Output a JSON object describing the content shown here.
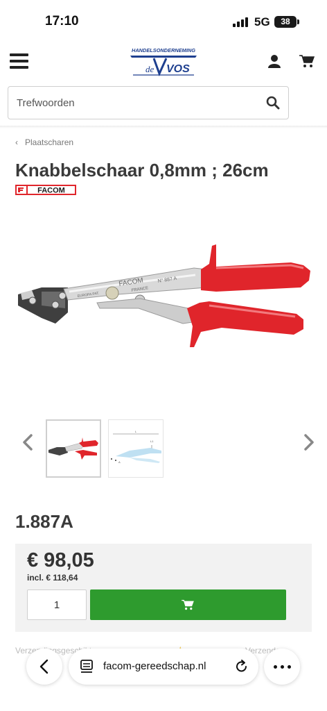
{
  "status_bar": {
    "time": "17:10",
    "network": "5G",
    "battery": "38"
  },
  "header": {
    "logo_top": "HANDELSONDERNEMING",
    "logo_de": "de",
    "logo_name": "VOS"
  },
  "search": {
    "placeholder": "Trefwoorden"
  },
  "breadcrumb": {
    "label": "Plaatscharen"
  },
  "product": {
    "title": "Knabbelschaar 0,8mm ; 26cm",
    "brand": "FACOM",
    "sku": "1.887A",
    "price": "€ 98,05",
    "price_incl": "incl. € 118,64",
    "quantity": "1",
    "image_engraving": "FACOM",
    "image_engraving_2": "FRANCE",
    "image_engraving_3": "N° 887 A",
    "image_engraving_4": "EUROPA PAT."
  },
  "gallery": {
    "thumbnail_dim_labels": [
      "L",
      "L1",
      "A"
    ]
  },
  "below_fold": {
    "shipping_left": "Verzendingsgeschikt",
    "shipping_right": "Verzenden"
  },
  "browser": {
    "url": "facom-gereedschap.nl"
  },
  "colors": {
    "add_to_cart": "#2e9b2e",
    "handle_red": "#e0252b",
    "price_box": "#f2f2f2",
    "logo_blue": "#1e3f8f"
  }
}
